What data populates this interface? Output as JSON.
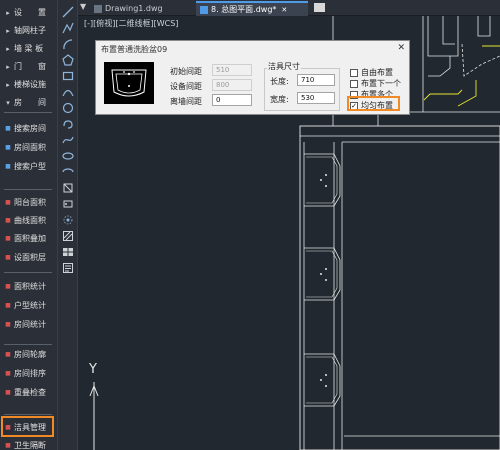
{
  "left_menu": {
    "items": [
      {
        "label": "设　　置",
        "kind": "category"
      },
      {
        "label": "轴网柱子",
        "kind": "category"
      },
      {
        "label": "墙 梁 板",
        "kind": "category"
      },
      {
        "label": "门　　窗",
        "kind": "category"
      },
      {
        "label": "楼梯设施",
        "kind": "category"
      },
      {
        "label": "房　　间",
        "kind": "category-open"
      },
      {
        "label": "搜索房间",
        "kind": "command"
      },
      {
        "label": "房间面积",
        "kind": "command"
      },
      {
        "label": "搜索户型",
        "kind": "command"
      },
      {
        "label": "阳台面积",
        "kind": "command"
      },
      {
        "label": "曲线面积",
        "kind": "command"
      },
      {
        "label": "面积叠加",
        "kind": "command"
      },
      {
        "label": "设面积层",
        "kind": "command"
      },
      {
        "label": "面积统计",
        "kind": "command"
      },
      {
        "label": "户型统计",
        "kind": "command"
      },
      {
        "label": "房间统计",
        "kind": "command"
      },
      {
        "label": "房间轮廓",
        "kind": "command"
      },
      {
        "label": "房间排序",
        "kind": "command"
      },
      {
        "label": "重叠检查",
        "kind": "command"
      },
      {
        "label": "洁具管理",
        "kind": "command-selected"
      },
      {
        "label": "卫生隔断",
        "kind": "command"
      }
    ]
  },
  "tabs": [
    {
      "label": "Drawing1.dwg",
      "active": false
    },
    {
      "label": "8. 总图平面.dwg*",
      "active": true
    }
  ],
  "view_label": "[-][俯视][二维线框][WCS]",
  "axis_label_y": "Y",
  "dialog": {
    "title": "布置普通洗脸盆09",
    "close_glyph": "✕",
    "initial_spacing_label": "初始间距",
    "initial_spacing_value": "510",
    "device_spacing_label": "设备间距",
    "device_spacing_value": "800",
    "wall_spacing_label": "离墙间距",
    "wall_spacing_value": "0",
    "size_group_title": "洁具尺寸",
    "length_label": "长度:",
    "length_value": "710",
    "width_label": "宽度:",
    "width_value": "530",
    "options": [
      {
        "label": "自由布置",
        "checked": false
      },
      {
        "label": "布置下一个",
        "checked": false
      },
      {
        "label": "布置多个",
        "checked": false
      },
      {
        "label": "均匀布置",
        "checked": true
      }
    ]
  },
  "colors": {
    "canvas_bg": "#212830",
    "highlight": "#f08a24",
    "cad_line": "#e6e6e6",
    "yellow_line": "#e6e62e",
    "toolbar_icon": "#8fb3d9"
  }
}
